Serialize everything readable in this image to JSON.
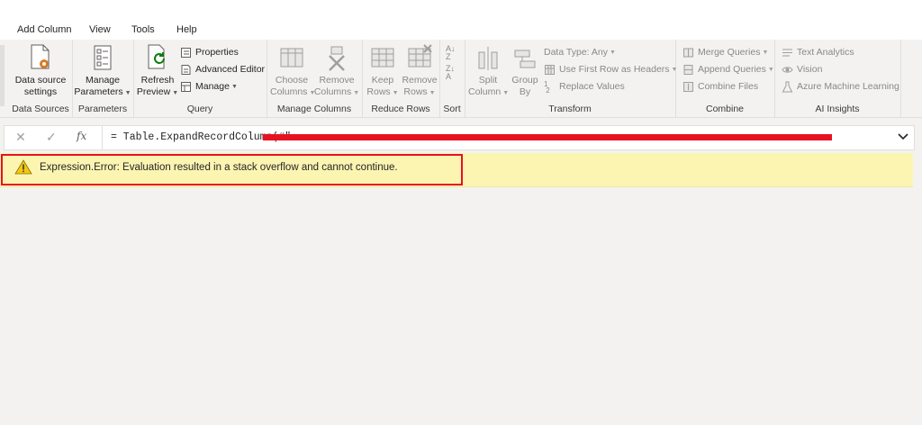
{
  "menu": [
    "Add Column",
    "View",
    "Tools",
    "Help"
  ],
  "ribbon": {
    "data_sources": {
      "label": "Data Sources",
      "btn_line1": "Data source",
      "btn_line2": "settings"
    },
    "parameters": {
      "label": "Parameters",
      "btn_line1": "Manage",
      "btn_line2": "Parameters"
    },
    "query": {
      "label": "Query",
      "refresh_line1": "Refresh",
      "refresh_line2": "Preview",
      "properties": "Properties",
      "advanced_editor": "Advanced Editor",
      "manage": "Manage"
    },
    "manage_columns": {
      "label": "Manage Columns",
      "choose_line1": "Choose",
      "choose_line2": "Columns",
      "remove_line1": "Remove",
      "remove_line2": "Columns"
    },
    "reduce_rows": {
      "label": "Reduce Rows",
      "keep_line1": "Keep",
      "keep_line2": "Rows",
      "remove_line1": "Remove",
      "remove_line2": "Rows"
    },
    "sort": {
      "label": "Sort"
    },
    "transform": {
      "label": "Transform",
      "split_line1": "Split",
      "split_line2": "Column",
      "group_line1": "Group",
      "group_line2": "By",
      "data_type": "Data Type: Any",
      "first_row": "Use First Row as Headers",
      "replace": "Replace Values"
    },
    "combine": {
      "label": "Combine",
      "merge": "Merge Queries",
      "append": "Append Queries",
      "combine_files": "Combine Files"
    },
    "ai_insights": {
      "label": "AI Insights",
      "text_analytics": "Text Analytics",
      "vision": "Vision",
      "azure_ml": "Azure Machine Learning"
    }
  },
  "formula": {
    "fx": "fx",
    "text": "= Table.ExpandRecordColumn(#\""
  },
  "error": {
    "message": "Expression.Error: Evaluation resulted in a stack overflow and cannot continue."
  }
}
